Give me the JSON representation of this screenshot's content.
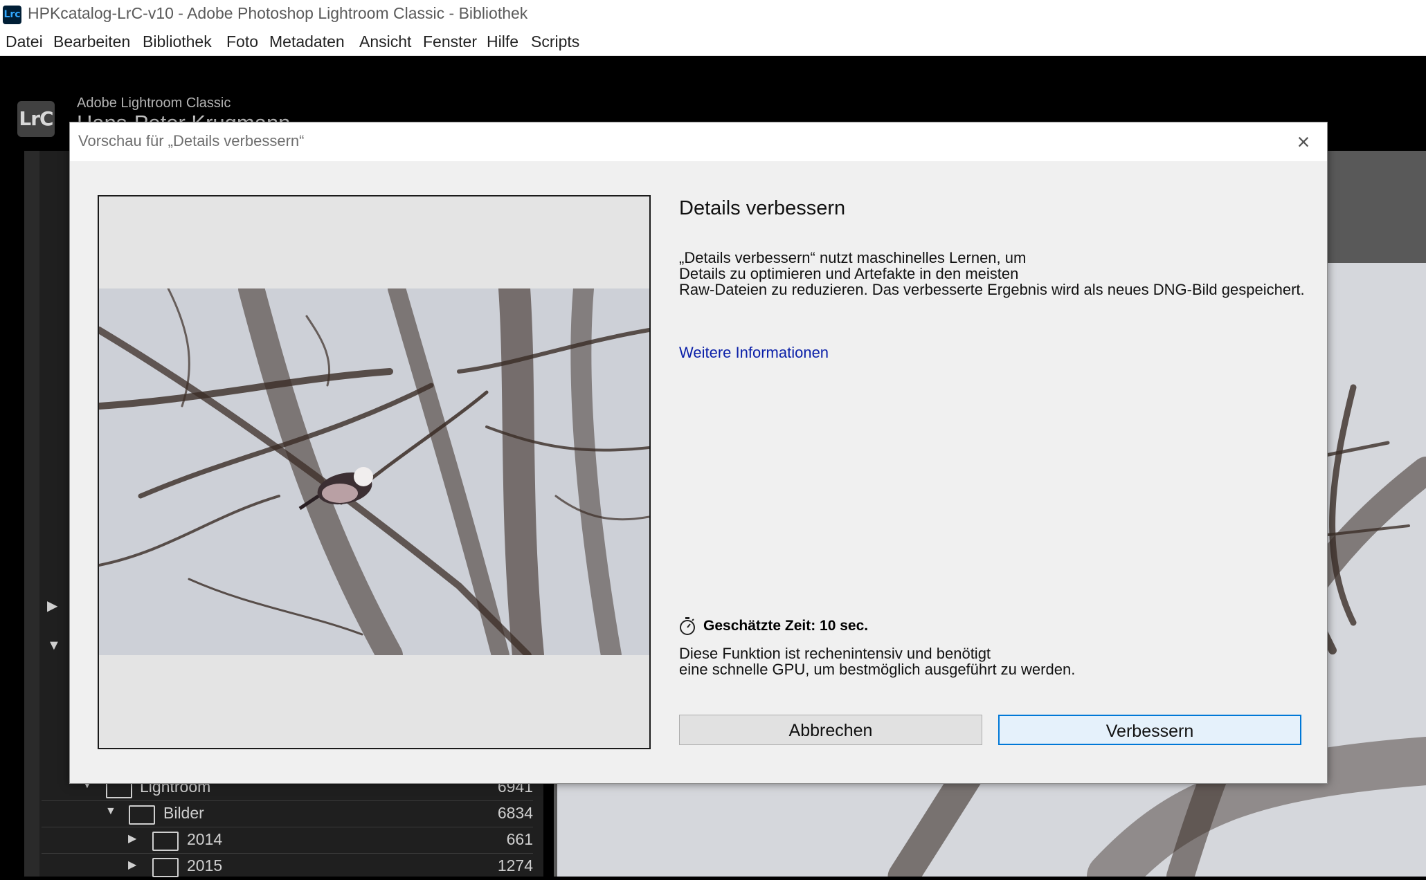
{
  "window": {
    "app_icon": "Lrc",
    "title": "HPKcatalog-LrC-v10 - Adobe Photoshop Lightroom Classic - Bibliothek"
  },
  "menu": [
    "Datei",
    "Bearbeiten",
    "Bibliothek",
    "Foto",
    "Metadaten",
    "Ansicht",
    "Fenster",
    "Hilfe",
    "Scripts"
  ],
  "lightroom": {
    "logo": "LrC",
    "app_name": "Adobe Lightroom Classic",
    "user_name": "Hans-Peter Krugmann",
    "folders": [
      {
        "name": "Lightroom",
        "count": "6941"
      },
      {
        "name": "Bilder",
        "count": "6834"
      },
      {
        "name": "2014",
        "count": "661"
      },
      {
        "name": "2015",
        "count": "1274"
      }
    ]
  },
  "dialog": {
    "title": "Vorschau für „Details verbessern“",
    "heading": "Details verbessern",
    "description": [
      "„Details verbessern“ nutzt maschinelles Lernen, um",
      "Details zu optimieren und Artefakte in den meisten",
      "Raw-Dateien zu reduzieren. Das verbesserte Ergebnis wird als neues DNG-Bild gespeichert."
    ],
    "more_info": "Weitere Informationen",
    "estimated_time": "Geschätzte Zeit: 10 sec.",
    "gpu_note": [
      "Diese Funktion ist rechenintensiv und benötigt",
      "eine schnelle GPU, um bestmöglich ausgeführt zu werden."
    ],
    "cancel_label": "Abbrechen",
    "confirm_label": "Verbessern",
    "timer_icon": "stopwatch-icon",
    "close_icon": "close-icon"
  },
  "colors": {
    "link": "#0a1fa8",
    "primary_button_border": "#0078d7",
    "app_badge": "#001e36"
  }
}
